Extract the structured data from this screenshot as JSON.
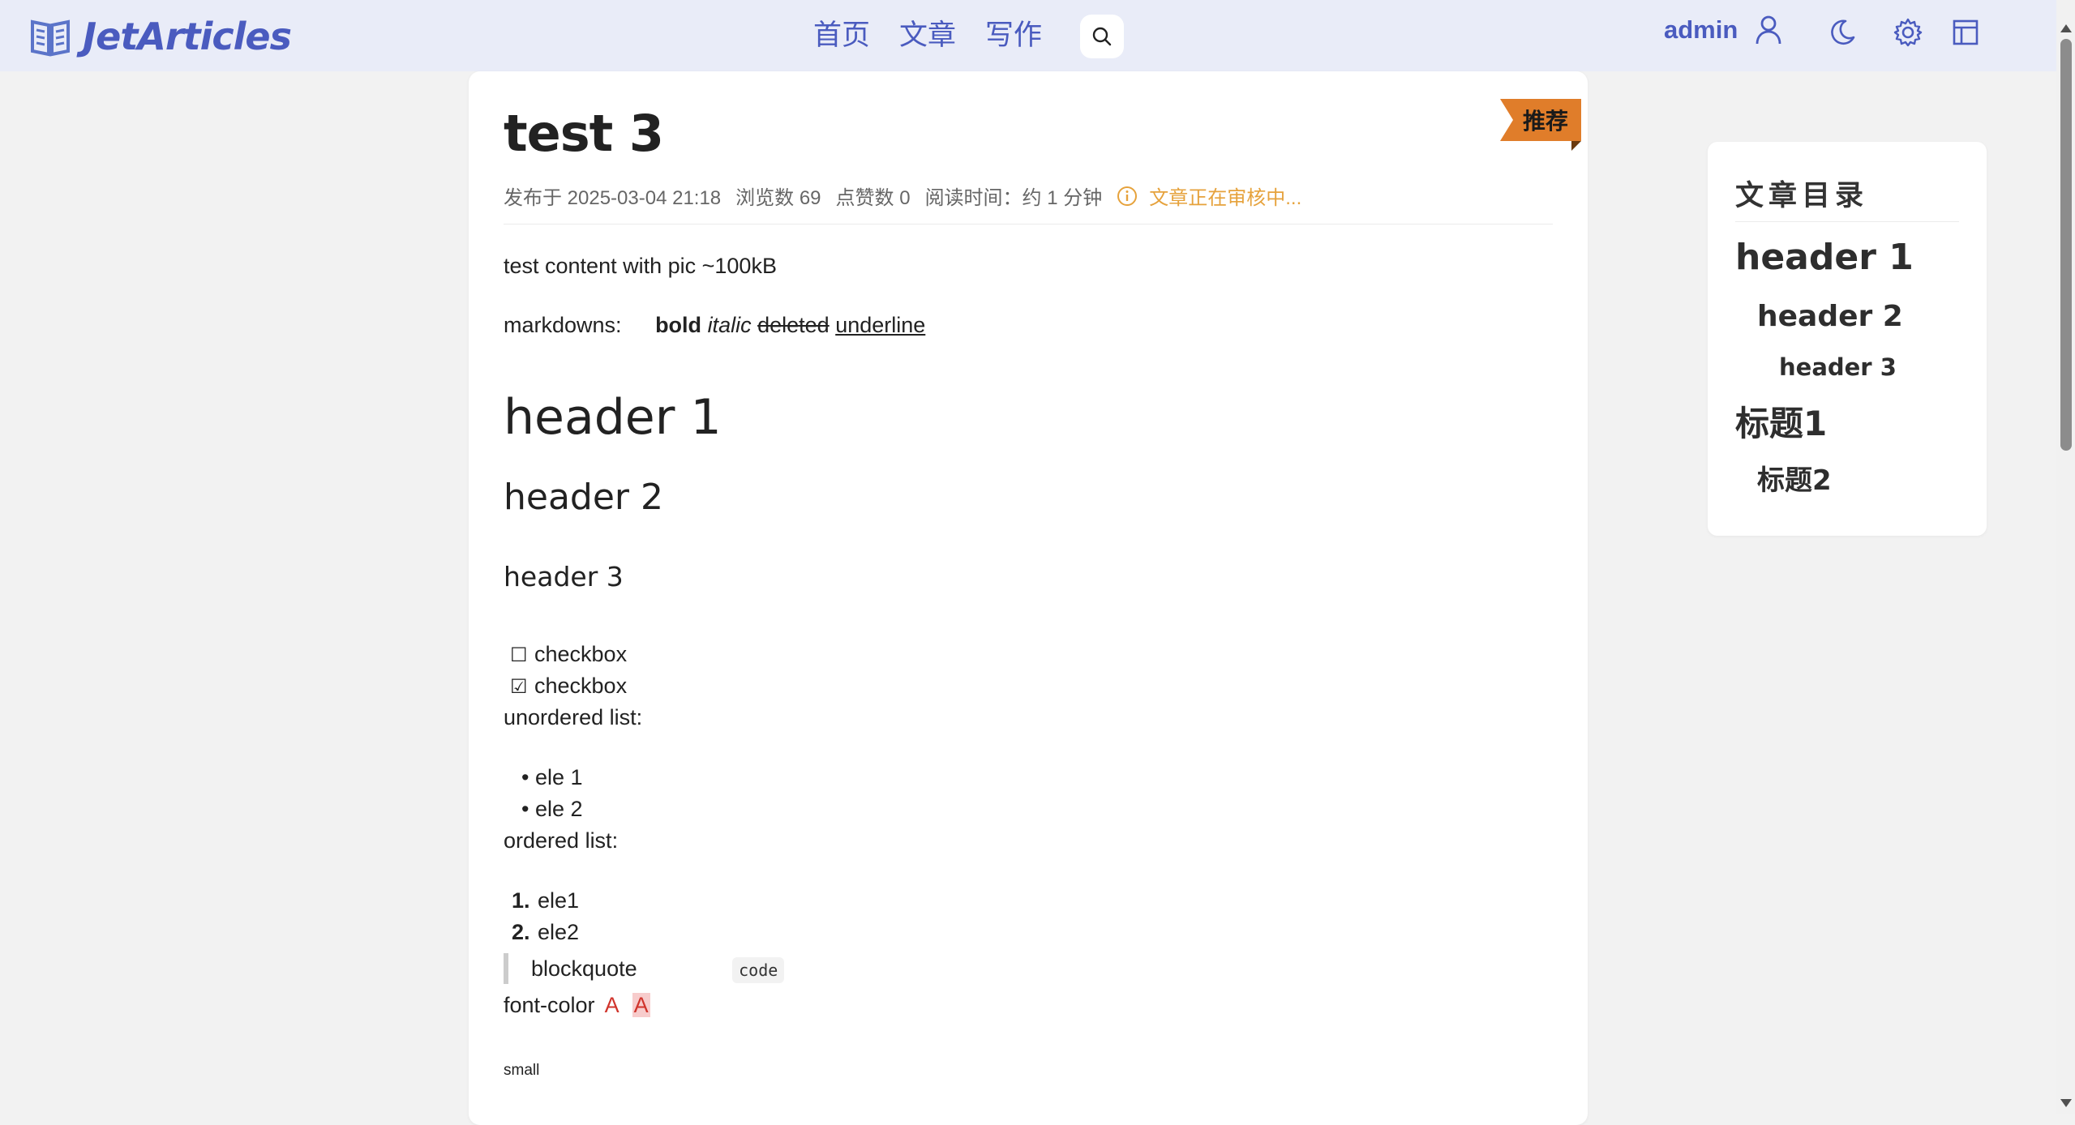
{
  "app": {
    "name": "JetArticles"
  },
  "nav": {
    "items": [
      "首页",
      "文章",
      "写作"
    ]
  },
  "user": {
    "name": "admin"
  },
  "article": {
    "title": "test 3",
    "badge": "推荐",
    "meta": {
      "published": "发布于 2025-03-04 21:18",
      "views": "浏览数 69",
      "likes": "点赞数 0",
      "reading_time": "阅读时间：约 1 分钟",
      "review_status": "文章正在审核中..."
    },
    "body": {
      "intro": "test content with pic ~100kB",
      "markdowns_label": "markdowns:",
      "bold": "bold",
      "italic": "italic",
      "deleted": "deleted",
      "underline": "underline",
      "h1": "header 1",
      "h2": "header 2",
      "h3": "header 3",
      "checkbox_unchecked_glyph": "☐",
      "checkbox_checked_glyph": "☑",
      "checkbox1": "checkbox",
      "checkbox2": "checkbox",
      "unordered_label": "unordered list:",
      "ul_bullet": "•",
      "ul": [
        "ele 1",
        "ele 2"
      ],
      "ordered_label": "ordered list:",
      "ol_numbers": [
        "1.",
        "2."
      ],
      "ol": [
        "ele1",
        "ele2"
      ],
      "blockquote": "blockquote",
      "code": "code",
      "font_color_label": "font-color",
      "font_color_a": "A",
      "font_bg_a": "A",
      "small": "small"
    }
  },
  "toc": {
    "title": "文章目录",
    "items": [
      {
        "label": "header 1",
        "level": 1
      },
      {
        "label": "header 2",
        "level": 2
      },
      {
        "label": "header 3",
        "level": 3
      },
      {
        "label": "标题1",
        "level": 1
      },
      {
        "label": "标题2",
        "level": 2
      }
    ]
  },
  "colors": {
    "brand": "#4a5bbf",
    "topbar_bg": "#e9ecf8",
    "badge": "#e07d2a",
    "review": "#e6a23c",
    "font_color": "#d0342c"
  },
  "icons": [
    "book-logo-icon",
    "search-icon",
    "user-icon",
    "moon-icon",
    "gear-icon",
    "layout-icon",
    "info-icon"
  ]
}
